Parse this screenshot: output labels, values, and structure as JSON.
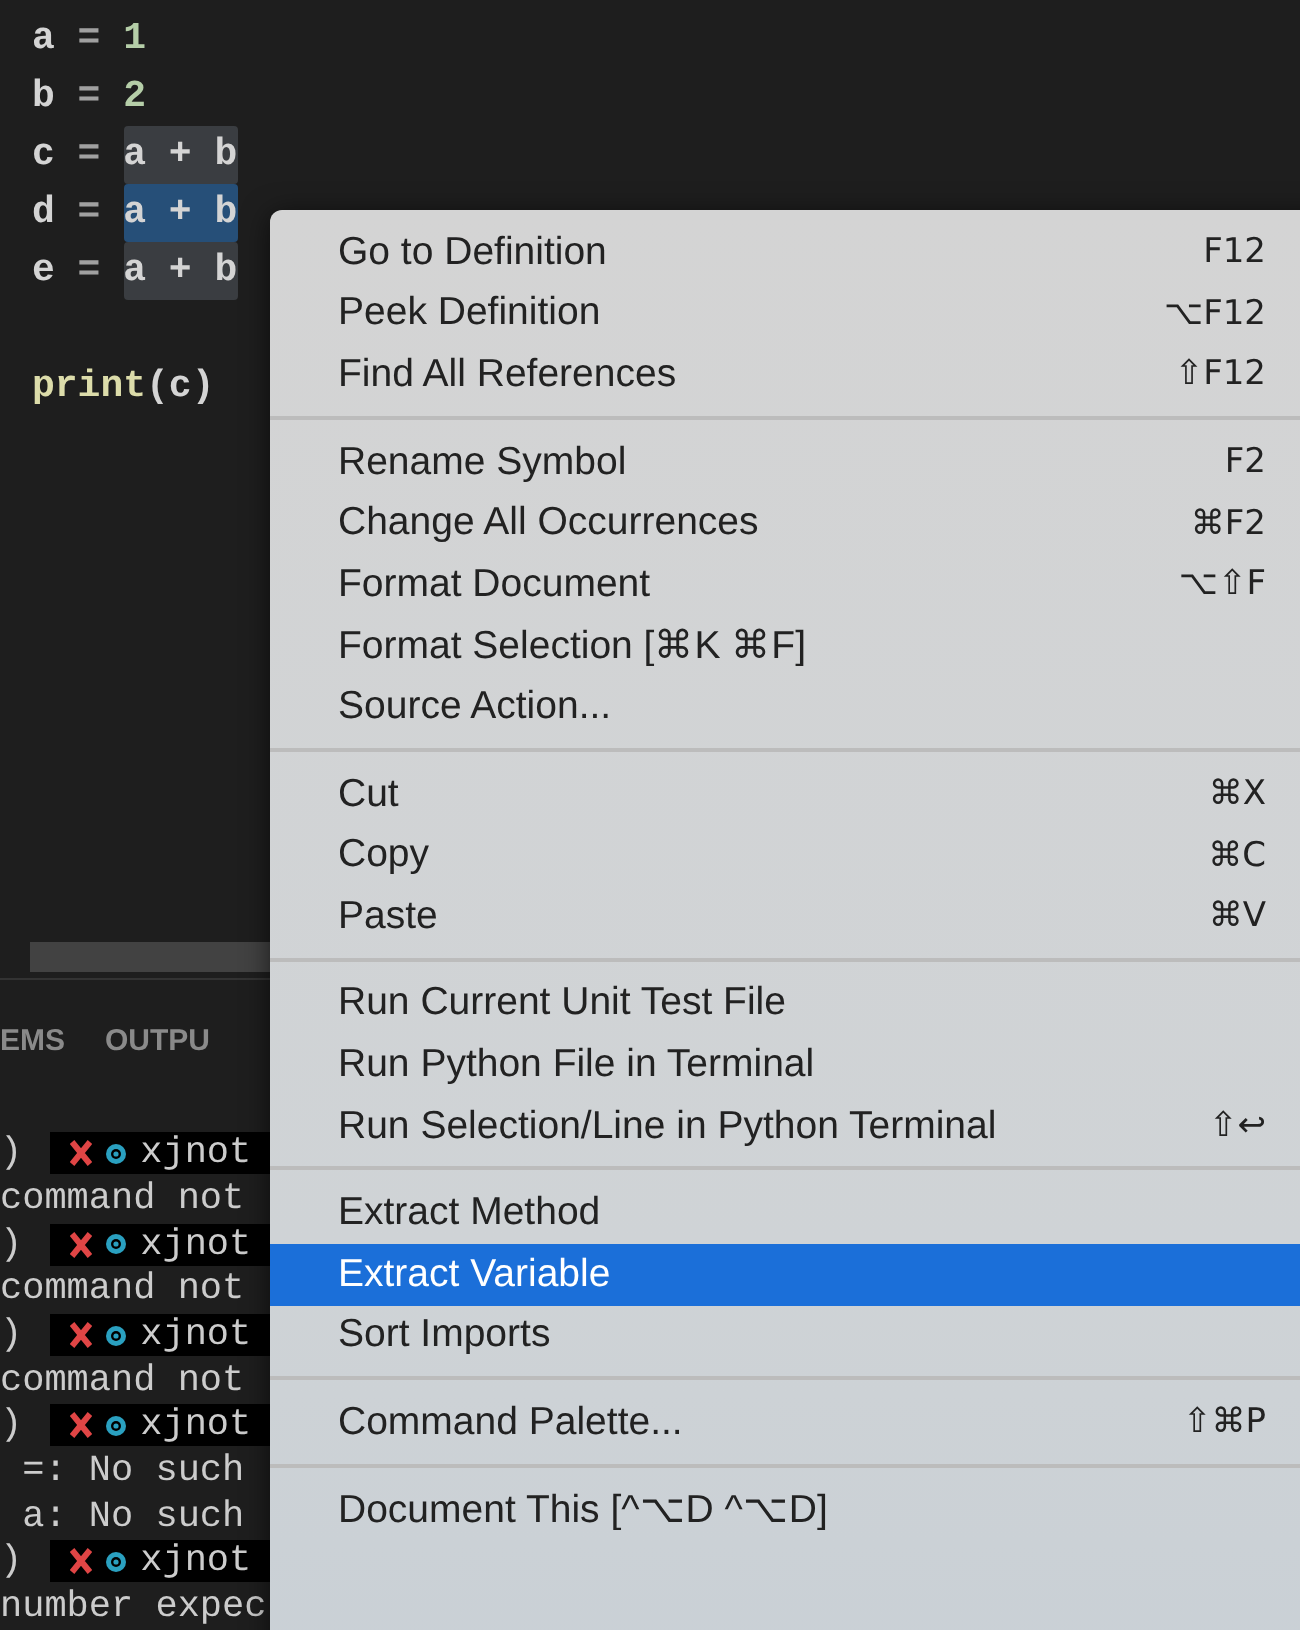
{
  "editor": {
    "lines": [
      {
        "tokens": [
          {
            "text": "a",
            "kind": "name"
          },
          {
            "text": " = ",
            "kind": "operator"
          },
          {
            "text": "1",
            "kind": "number"
          }
        ]
      },
      {
        "tokens": [
          {
            "text": "b",
            "kind": "name"
          },
          {
            "text": " = ",
            "kind": "operator"
          },
          {
            "text": "2",
            "kind": "number"
          }
        ]
      },
      {
        "tokens": [
          {
            "text": "c",
            "kind": "name"
          },
          {
            "text": " = ",
            "kind": "operator"
          },
          {
            "text": "a + b",
            "kind": "name",
            "highlighted": true,
            "selected": false
          }
        ]
      },
      {
        "tokens": [
          {
            "text": "d",
            "kind": "name"
          },
          {
            "text": " = ",
            "kind": "operator"
          },
          {
            "text": "a + b",
            "kind": "name",
            "highlighted": true,
            "selected": true
          }
        ]
      },
      {
        "tokens": [
          {
            "text": "e",
            "kind": "name"
          },
          {
            "text": " = ",
            "kind": "operator"
          },
          {
            "text": "a + b",
            "kind": "name",
            "highlighted": true,
            "selected": false
          }
        ]
      },
      {
        "kind": "blank"
      },
      {
        "tokens": [
          {
            "text": "print",
            "kind": "function"
          },
          {
            "text": "(c)",
            "kind": "name"
          }
        ]
      }
    ]
  },
  "panel": {
    "tabs": [
      {
        "label": "EMS"
      },
      {
        "label": "OUTPU"
      }
    ],
    "terminal": [
      {
        "kind": "prompt",
        "prefix": ")",
        "text": "xjnot"
      },
      {
        "kind": "output",
        "text": "command not"
      },
      {
        "kind": "prompt",
        "prefix": ")",
        "text": "xjnot"
      },
      {
        "kind": "output",
        "text": "command not"
      },
      {
        "kind": "prompt",
        "prefix": ")",
        "text": "xjnot"
      },
      {
        "kind": "output",
        "text": "command not"
      },
      {
        "kind": "prompt",
        "prefix": ")",
        "text": "xjnot"
      },
      {
        "kind": "output",
        "text": " =: No such"
      },
      {
        "kind": "output",
        "text": " a: No such"
      },
      {
        "kind": "prompt",
        "prefix": ")",
        "text": "xjnot"
      },
      {
        "kind": "output",
        "text": "number expec"
      }
    ]
  },
  "context_menu": {
    "groups": [
      {
        "items": [
          {
            "label": "Go to Definition",
            "shortcut": "F12",
            "selected": false
          },
          {
            "label": "Peek Definition",
            "shortcut": "⌥F12",
            "selected": false
          },
          {
            "label": "Find All References",
            "shortcut": "⇧F12",
            "selected": false
          }
        ]
      },
      {
        "items": [
          {
            "label": "Rename Symbol",
            "shortcut": "F2",
            "selected": false
          },
          {
            "label": "Change All Occurrences",
            "shortcut": "⌘F2",
            "selected": false
          },
          {
            "label": "Format Document",
            "shortcut": "⌥⇧F",
            "selected": false
          },
          {
            "label": "Format Selection [⌘K ⌘F]",
            "selected": false
          },
          {
            "label": "Source Action...",
            "selected": false
          }
        ]
      },
      {
        "items": [
          {
            "label": "Cut",
            "shortcut": "⌘X",
            "selected": false
          },
          {
            "label": "Copy",
            "shortcut": "⌘C",
            "selected": false
          },
          {
            "label": "Paste",
            "shortcut": "⌘V",
            "selected": false
          }
        ]
      },
      {
        "items": [
          {
            "label": "Run Current Unit Test File",
            "selected": false
          },
          {
            "label": "Run Python File in Terminal",
            "selected": false
          },
          {
            "label": "Run Selection/Line in Python Terminal",
            "shortcut": "⇧↩",
            "selected": false
          }
        ]
      },
      {
        "items": [
          {
            "label": "Extract Method",
            "selected": false
          },
          {
            "label": "Extract Variable",
            "selected": true
          },
          {
            "label": "Sort Imports",
            "selected": false
          }
        ]
      },
      {
        "items": [
          {
            "label": "Command Palette...",
            "shortcut": "⇧⌘P",
            "selected": false
          }
        ]
      },
      {
        "items": [
          {
            "label": "Document This [^⌥D ^⌥D]",
            "selected": false
          }
        ]
      }
    ]
  }
}
